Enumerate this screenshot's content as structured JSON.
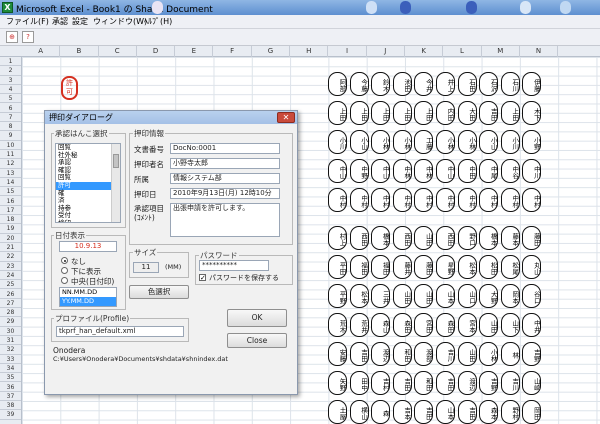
{
  "window": {
    "title": "Microsoft Excel - Book1 の Shank Document",
    "icon": "X"
  },
  "menu": [
    "ファイル(F)",
    "承認",
    "設定",
    "ウィンドウ(W)",
    "ﾍﾙﾌﾟ(H)"
  ],
  "toolbar": [
    {
      "icon": "stamp-icon",
      "glyph": "⊕"
    },
    {
      "icon": "help-icon",
      "glyph": "?"
    }
  ],
  "columns": [
    "A",
    "B",
    "C",
    "D",
    "E",
    "F",
    "G",
    "H",
    "I",
    "J",
    "K",
    "L",
    "M",
    "N"
  ],
  "rows": [
    "1",
    "2",
    "3",
    "4",
    "5",
    "6",
    "7",
    "8",
    "9",
    "10",
    "11",
    "12",
    "13",
    "14",
    "15",
    "16",
    "17",
    "18",
    "19",
    "20",
    "21",
    "22",
    "23",
    "24",
    "25",
    "26",
    "27",
    "28",
    "29",
    "30",
    "31",
    "32",
    "33",
    "34",
    "35",
    "36",
    "37",
    "38",
    "39"
  ],
  "hanko_sample": "許可",
  "seals_top": [
    [
      "阿部",
      "今藤",
      "鈴木",
      "池田",
      "今井",
      "井上",
      "石田",
      "石沢",
      "石川",
      "伊藤"
    ],
    [
      "上田",
      "上田",
      "上田",
      "上田",
      "上田",
      "内田",
      "大田",
      "吉田",
      "上田",
      "木下"
    ],
    [
      "小川",
      "小山",
      "小林",
      "小林",
      "工藤",
      "小林",
      "小林",
      "小山",
      "小川",
      "小野"
    ],
    [
      "中山",
      "中野",
      "中山",
      "中林",
      "中林",
      "中山",
      "中田",
      "中尾",
      "中谷",
      "中川"
    ],
    [
      "中村",
      "中村",
      "中村",
      "中村",
      "中村",
      "中村",
      "中村",
      "中村",
      "中村",
      "中村"
    ]
  ],
  "seals_bottom": [
    [
      "村上",
      "西田",
      "橋本",
      "西田",
      "山田",
      "西田",
      "野口",
      "橋本",
      "藤本",
      "藤田"
    ],
    [
      "平田",
      "福田",
      "福田",
      "藤井",
      "藤田",
      "星野",
      "松本",
      "松田",
      "松尾",
      "丸山"
    ],
    [
      "平野",
      "松本",
      "三井",
      "山田",
      "山田",
      "山本",
      "山口",
      "大野",
      "岡本",
      "谷口"
    ],
    [
      "荒木",
      "荒井",
      "森山",
      "森田",
      "宮田",
      "森田",
      "宮本",
      "山田",
      "山下",
      "中井"
    ],
    [
      "安藤",
      "吉田",
      "渡辺",
      "和田",
      "渡部",
      "吉川",
      "山田",
      "小林",
      "林",
      "吉野"
    ],
    [
      "矢野",
      "田中",
      "吉村",
      "吉田",
      "和田",
      "吉田",
      "渡辺",
      "吉野",
      "吉川",
      "山崎"
    ],
    [
      "土屋",
      "横山",
      "森",
      "吉本",
      "吉田",
      "山本",
      "吉田",
      "森本",
      "野村",
      "岡田"
    ]
  ],
  "dialog": {
    "title": "押印ダイアローグ",
    "approve_group": "承認はんこ選択",
    "approve_list": [
      "回覧",
      "社外秘",
      "承認",
      "確認",
      "回覧",
      "許可",
      "確",
      "済",
      "持参",
      "受付",
      "検印"
    ],
    "approve_selected_index": 5,
    "info_group": "押印情報",
    "doc_no_label": "文書番号",
    "doc_no_value": "DocNo:0001",
    "person_label": "押印者名",
    "person_value": "小野寺太郎",
    "dept_label": "所属",
    "dept_value": "情報システム部",
    "date_label": "押印日",
    "date_value": "2010年9月13日(月) 12時10分",
    "item_label": "承認項目\n(ｺﾒﾝﾄ)",
    "item_value": "出張申請を許可します。",
    "date_group": "日付表示",
    "date_preview": "10.9.13",
    "radio_none": "なし",
    "radio_below": "下に表示",
    "radio_center": "中央(日付印)",
    "date_format_list": [
      "NN.MM.DD",
      "YY.MM.DD"
    ],
    "date_format_selected_index": 1,
    "size_label": "サイズ",
    "size_value": "11",
    "size_unit": "(MM)",
    "color_button": "色選択",
    "password_group": "パスワード",
    "password_value": "**********",
    "password_save": "パスワードを保存する",
    "profile_group": "プロファイル(Profile)",
    "profile_value": "tkprf_han_default.xml",
    "ok_button": "OK",
    "close_button": "Close",
    "user": "Onodera",
    "path": "C:¥Users¥Onodera¥Documents¥shdata¥shnindex.dat"
  }
}
